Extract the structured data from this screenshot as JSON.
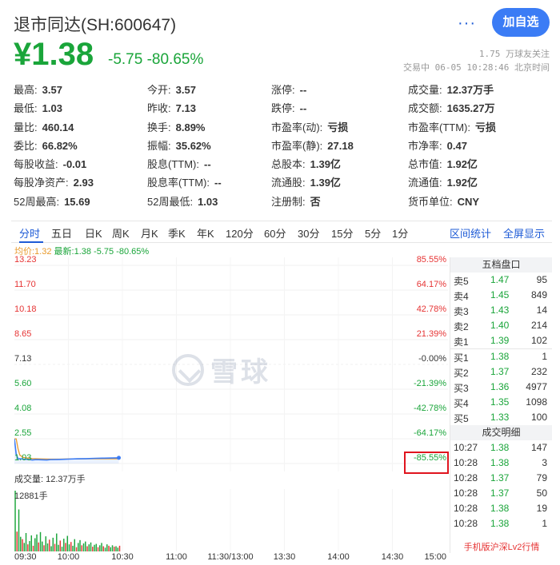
{
  "header": {
    "title": "退市同达(SH:600647)",
    "more_label": "···",
    "add_label": "加自选"
  },
  "price": {
    "current": "¥1.38",
    "change": "-5.75  -80.65%",
    "followers": "1.75 万球友关注",
    "status": "交易中 06-05 10:28:46 北京时间"
  },
  "quote": [
    [
      {
        "label": "最高:",
        "value": "3.57",
        "color": "green"
      },
      {
        "label": "今开:",
        "value": "3.57",
        "color": "green"
      },
      {
        "label": "涨停:",
        "value": "--",
        "color": "normal"
      },
      {
        "label": "成交量:",
        "value": "12.37万手",
        "color": "normal"
      }
    ],
    [
      {
        "label": "最低:",
        "value": "1.03",
        "color": "green"
      },
      {
        "label": "昨收:",
        "value": "7.13",
        "color": "normal"
      },
      {
        "label": "跌停:",
        "value": "--",
        "color": "normal"
      },
      {
        "label": "成交额:",
        "value": "1635.27万",
        "color": "normal"
      }
    ],
    [
      {
        "label": "量比:",
        "value": "460.14",
        "color": "red"
      },
      {
        "label": "换手:",
        "value": "8.89%",
        "color": "normal"
      },
      {
        "label": "市盈率(动):",
        "value": "亏损",
        "color": "normal"
      },
      {
        "label": "市盈率(TTM):",
        "value": "亏损",
        "color": "normal"
      }
    ],
    [
      {
        "label": "委比:",
        "value": "66.82%",
        "color": "red"
      },
      {
        "label": "振幅:",
        "value": "35.62%",
        "color": "normal"
      },
      {
        "label": "市盈率(静):",
        "value": "27.18",
        "color": "normal"
      },
      {
        "label": "市净率:",
        "value": "0.47",
        "color": "normal"
      }
    ],
    [
      {
        "label": "每股收益:",
        "value": "-0.01",
        "color": "normal"
      },
      {
        "label": "股息(TTM):",
        "value": "--",
        "color": "normal"
      },
      {
        "label": "总股本:",
        "value": "1.39亿",
        "color": "normal"
      },
      {
        "label": "总市值:",
        "value": "1.92亿",
        "color": "normal"
      }
    ],
    [
      {
        "label": "每股净资产:",
        "value": "2.93",
        "color": "normal"
      },
      {
        "label": "股息率(TTM):",
        "value": "--",
        "color": "normal"
      },
      {
        "label": "流通股:",
        "value": "1.39亿",
        "color": "normal"
      },
      {
        "label": "流通值:",
        "value": "1.92亿",
        "color": "normal"
      }
    ],
    [
      {
        "label": "52周最高:",
        "value": "15.69",
        "color": "normal"
      },
      {
        "label": "52周最低:",
        "value": "1.03",
        "color": "normal"
      },
      {
        "label": "注册制:",
        "value": "否",
        "color": "normal"
      },
      {
        "label": "货币单位:",
        "value": "CNY",
        "color": "normal"
      }
    ]
  ],
  "tabs": [
    "分时",
    "五日",
    "日K",
    "周K",
    "月K",
    "季K",
    "年K",
    "120分",
    "60分",
    "30分",
    "15分",
    "5分",
    "1分"
  ],
  "tab_right": [
    "区间统计",
    "全屏显示"
  ],
  "avg_line": {
    "avg": "均价:1.32",
    "latest": "最新:1.38 -5.75 -80.65%"
  },
  "chart_data": {
    "type": "line",
    "prev_close": 7.13,
    "ylim": [
      1.03,
      13.23
    ],
    "y_ticks_left": [
      "13.23",
      "11.70",
      "10.18",
      "8.65",
      "7.13",
      "5.60",
      "4.08",
      "2.55",
      "1.03"
    ],
    "y_ticks_right": [
      "85.55%",
      "64.17%",
      "42.78%",
      "21.39%",
      "-0.00%",
      "-21.39%",
      "-42.78%",
      "-64.17%",
      "-85.55%"
    ],
    "x_labels": [
      "09:30",
      "10:00",
      "10:30",
      "11:00",
      "11:30/13:00",
      "13:30",
      "14:00",
      "14:30",
      "15:00"
    ],
    "total_minutes": 240,
    "price_minutes": [
      0,
      1,
      2,
      3,
      5,
      8,
      10,
      12,
      15,
      18,
      20,
      25,
      30,
      35,
      40,
      45,
      50,
      55,
      58
    ],
    "price_values": [
      2.55,
      1.6,
      1.33,
      1.32,
      1.3,
      1.28,
      1.25,
      1.27,
      1.26,
      1.25,
      1.27,
      1.28,
      1.3,
      1.32,
      1.33,
      1.35,
      1.36,
      1.37,
      1.38
    ],
    "avg_minutes": [
      0,
      1,
      2,
      3,
      5,
      10,
      15,
      20,
      25,
      30,
      35,
      40,
      45,
      50,
      55,
      58
    ],
    "avg_values": [
      2.55,
      2.55,
      1.95,
      1.55,
      1.4,
      1.33,
      1.31,
      1.3,
      1.3,
      1.31,
      1.31,
      1.32,
      1.32,
      1.32,
      1.32,
      1.32
    ],
    "volume_label": "成交量: 12.37万手",
    "volume_max": "12881手",
    "volume_max_value": 12881,
    "volumes": [
      12881,
      4200,
      8900,
      3100,
      2600,
      1800,
      3900,
      1500,
      2200,
      3400,
      1200,
      2800,
      3600,
      1900,
      4100,
      2100,
      1300,
      3200,
      1700,
      2500,
      1100,
      2900,
      1600,
      3800,
      1400,
      2300,
      1000,
      2700,
      1800,
      3300,
      1500,
      2000,
      1200,
      2600,
      900,
      1800,
      2400,
      1300,
      1700,
      2100,
      1100,
      1500,
      1900,
      1000,
      1400,
      1600,
      900,
      1300,
      1800,
      1100,
      800,
      1500,
      1200,
      900,
      1300,
      1000,
      1100,
      800,
      1200
    ]
  },
  "order_book": {
    "title": "五档盘口",
    "asks": [
      {
        "label": "卖5",
        "price": "1.47",
        "vol": "95"
      },
      {
        "label": "卖4",
        "price": "1.45",
        "vol": "849"
      },
      {
        "label": "卖3",
        "price": "1.43",
        "vol": "14"
      },
      {
        "label": "卖2",
        "price": "1.40",
        "vol": "214"
      },
      {
        "label": "卖1",
        "price": "1.39",
        "vol": "102"
      }
    ],
    "bids": [
      {
        "label": "买1",
        "price": "1.38",
        "vol": "1"
      },
      {
        "label": "买2",
        "price": "1.37",
        "vol": "232"
      },
      {
        "label": "买3",
        "price": "1.36",
        "vol": "4977"
      },
      {
        "label": "买4",
        "price": "1.35",
        "vol": "1098"
      },
      {
        "label": "买5",
        "price": "1.33",
        "vol": "100"
      }
    ],
    "trades_title": "成交明细",
    "trades": [
      {
        "time": "10:27",
        "price": "1.38",
        "vol": "147",
        "dir": "red"
      },
      {
        "time": "10:28",
        "price": "1.38",
        "vol": "3",
        "dir": "normal"
      },
      {
        "time": "10:28",
        "price": "1.37",
        "vol": "79",
        "dir": "green"
      },
      {
        "time": "10:28",
        "price": "1.37",
        "vol": "50",
        "dir": "green"
      },
      {
        "time": "10:28",
        "price": "1.38",
        "vol": "19",
        "dir": "red"
      },
      {
        "time": "10:28",
        "price": "1.38",
        "vol": "1",
        "dir": "red"
      }
    ],
    "footer": "手机版沪深Lv2行情"
  },
  "watermark": "雪球",
  "colors": {
    "up": "#e63434",
    "down": "#1aa53a",
    "accent": "#3b7cf5",
    "price_line": "#3b7cf5",
    "avg_line": "#e89a2c"
  }
}
